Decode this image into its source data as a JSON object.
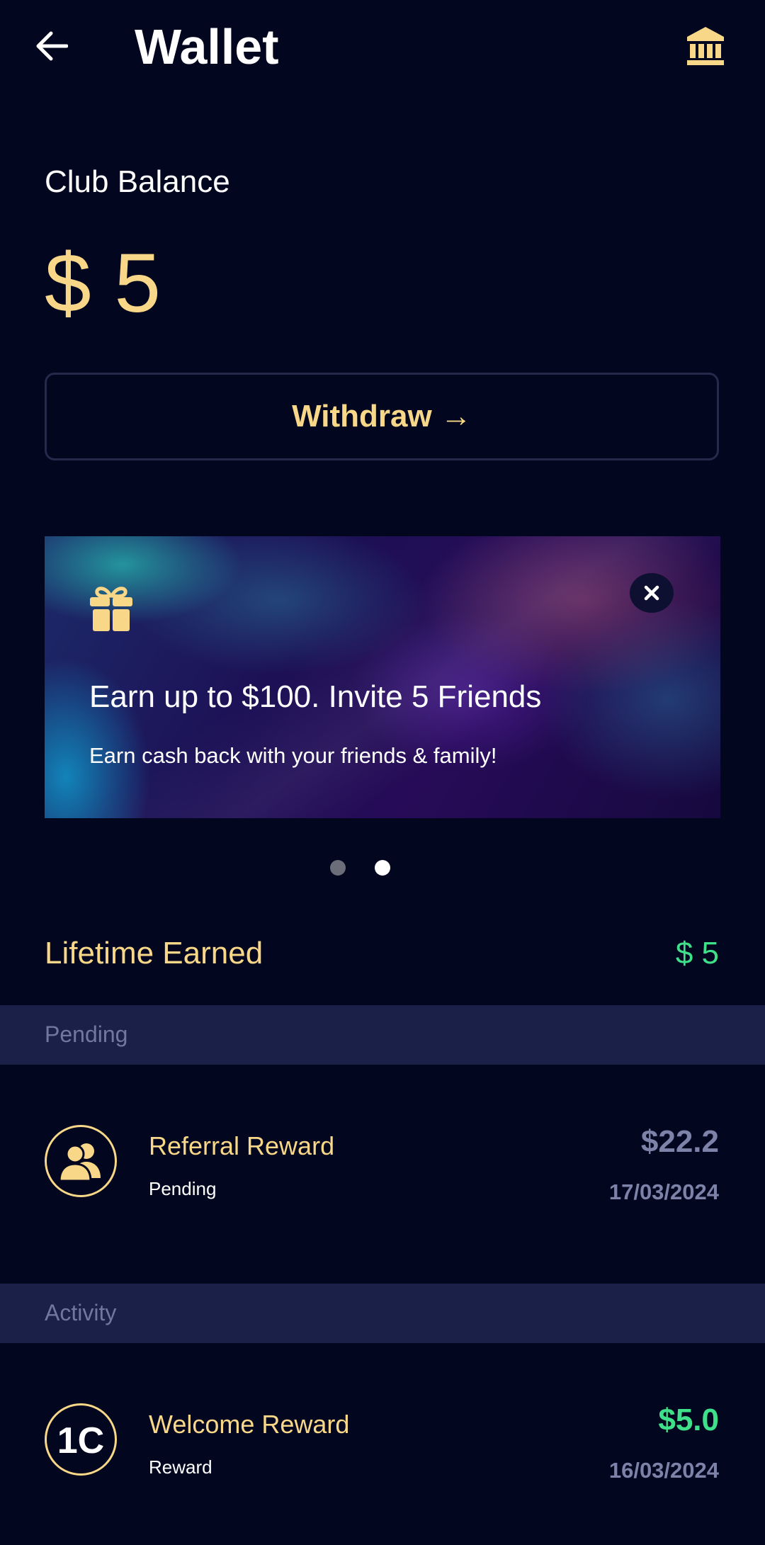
{
  "header": {
    "title": "Wallet",
    "back_icon": "arrow-left-icon",
    "bank_icon": "bank-icon"
  },
  "balance": {
    "label": "Club Balance",
    "amount": "$ 5"
  },
  "withdraw": {
    "label": "Withdraw →"
  },
  "promo": {
    "icon": "gift-icon",
    "title": "Earn up to $100. Invite 5 Friends",
    "subtitle": "Earn cash back with your friends & family!",
    "close_icon": "close-icon"
  },
  "carousel": {
    "total": 2,
    "active_index": 2
  },
  "lifetime": {
    "label": "Lifetime Earned",
    "value": "$ 5"
  },
  "sections": {
    "pending": {
      "label": "Pending",
      "items": [
        {
          "title": "Referral Reward",
          "status": "Pending",
          "amount": "$22.2",
          "date": "17/03/2024",
          "icon": "referral-users-icon"
        }
      ]
    },
    "activity": {
      "label": "Activity",
      "items": [
        {
          "title": "Welcome Reward",
          "status": "Reward",
          "amount": "$5.0",
          "date": "16/03/2024",
          "icon": "1c-logo-icon",
          "logo_text": "1C"
        }
      ]
    }
  },
  "colors": {
    "background": "#03061f",
    "accent_gold": "#f8d888",
    "positive_green": "#3ee08a",
    "muted": "#7c82a8",
    "section_bar": "#1b2048"
  }
}
